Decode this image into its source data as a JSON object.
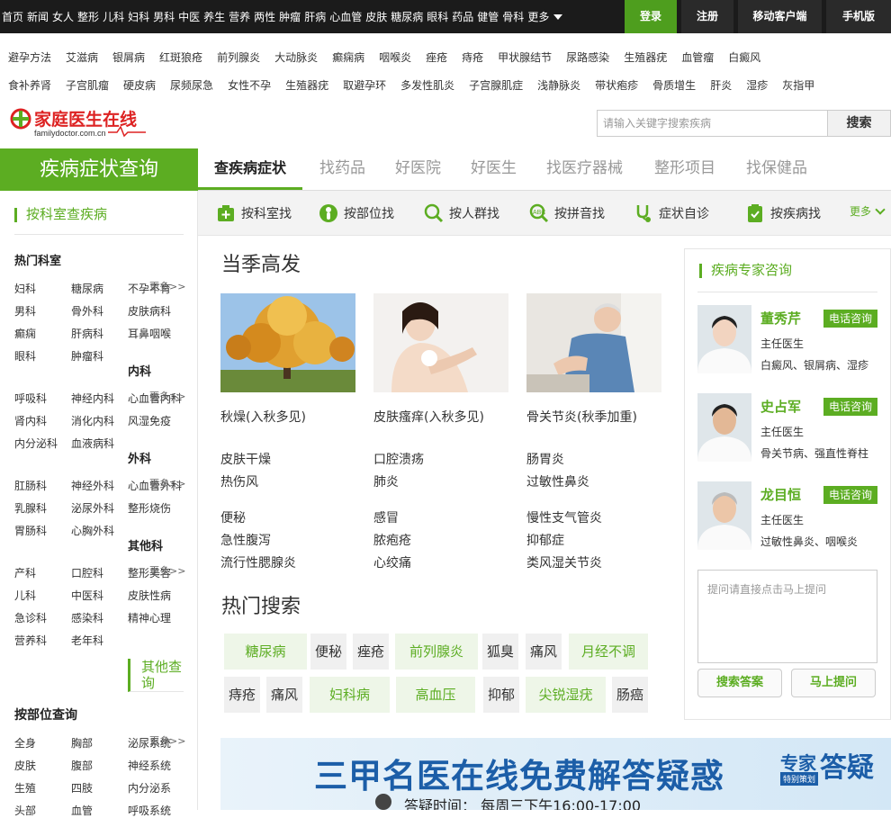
{
  "topnav": {
    "items": [
      "首页",
      "新闻",
      "女人",
      "整形",
      "儿科",
      "妇科",
      "男科",
      "中医",
      "养生",
      "营养",
      "两性",
      "肿瘤",
      "肝病",
      "心血管",
      "皮肤",
      "糖尿病",
      "眼科",
      "药品",
      "健管",
      "骨科",
      "更多"
    ],
    "login": "登录",
    "register": "注册",
    "mobile_client": "移动客户端",
    "phone_version": "手机版"
  },
  "keywords": {
    "row1": [
      "避孕方法",
      "艾滋病",
      "银屑病",
      "红斑狼疮",
      "前列腺炎",
      "大动脉炎",
      "癫痫病",
      "咽喉炎",
      "痤疮",
      "痔疮",
      "甲状腺结节",
      "尿路感染",
      "生殖器疣",
      "血管瘤",
      "白癜风"
    ],
    "row2": [
      "食补养肾",
      "子宫肌瘤",
      "硬皮病",
      "尿频尿急",
      "女性不孕",
      "生殖器疣",
      "取避孕环",
      "多发性肌炎",
      "子宫腺肌症",
      "浅静脉炎",
      "带状疱疹",
      "骨质增生",
      "肝炎",
      "湿疹",
      "灰指甲"
    ]
  },
  "logo": {
    "name": "家庭医生在线",
    "domain": "familydoctor.com.cn"
  },
  "search": {
    "placeholder": "请输入关键字搜索疾病",
    "button": "搜索"
  },
  "nav_title": "疾病症状查询",
  "main_tabs": [
    "查疾病症状",
    "找药品",
    "好医院",
    "好医生",
    "找医疗器械",
    "整形项目",
    "找保健品"
  ],
  "left": {
    "section1_title": "按科室查疾病",
    "hot_dept": "热门科室",
    "hot_dept_items": [
      [
        "妇科",
        "糖尿病",
        "不孕不育"
      ],
      [
        "男科",
        "骨外科",
        "皮肤病科"
      ],
      [
        "癫痫",
        "肝病科",
        "耳鼻咽喉"
      ],
      [
        "眼科",
        "肿瘤科",
        ""
      ]
    ],
    "more": "更多>>",
    "internal": "内科",
    "internal_items": [
      [
        "呼吸科",
        "神经内科",
        "心血管内科"
      ],
      [
        "肾内科",
        "消化内科",
        "风湿免疫"
      ],
      [
        "内分泌科",
        "血液病科",
        ""
      ]
    ],
    "surgery": "外科",
    "surgery_items": [
      [
        "肛肠科",
        "神经外科",
        "心血管外科"
      ],
      [
        "乳腺科",
        "泌尿外科",
        "整形烧伤"
      ],
      [
        "胃肠科",
        "心胸外科",
        ""
      ]
    ],
    "other": "其他科",
    "other_items": [
      [
        "产科",
        "口腔科",
        "整形美容"
      ],
      [
        "儿科",
        "中医科",
        "皮肤性病"
      ],
      [
        "急诊科",
        "感染科",
        "精神心理"
      ],
      [
        "营养科",
        "老年科",
        ""
      ]
    ],
    "other_query": "其他查询",
    "section2_title": "按部位查询",
    "body_items": [
      [
        "全身",
        "胸部",
        "泌尿系统"
      ],
      [
        "皮肤",
        "腹部",
        "神经系统"
      ],
      [
        "生殖",
        "四肢",
        "内分泌系"
      ],
      [
        "头部",
        "血管",
        "呼吸系统"
      ]
    ]
  },
  "subnav": [
    "按科室找",
    "按部位找",
    "按人群找",
    "按拼音找",
    "症状自诊",
    "按疾病找"
  ],
  "subnav_more": "更多",
  "season": {
    "title": "当季高发",
    "cards": [
      {
        "caption": "秋燥(入秋多见)"
      },
      {
        "caption": "皮肤瘙痒(入秋多见)"
      },
      {
        "caption": "骨关节炎(秋季加重)"
      }
    ],
    "diseases": [
      [
        "皮肤干燥",
        "口腔溃疡",
        "肠胃炎"
      ],
      [
        "热伤风",
        "肺炎",
        "过敏性鼻炎"
      ],
      [
        "便秘",
        "感冒",
        "慢性支气管炎"
      ],
      [
        "急性腹泻",
        "脓疱疮",
        "抑郁症"
      ],
      [
        "流行性腮腺炎",
        "心绞痛",
        "类风湿关节炎"
      ]
    ]
  },
  "hot_search": {
    "title": "热门搜索",
    "row1": [
      "糖尿病",
      "便秘",
      "痤疮",
      "前列腺炎",
      "狐臭",
      "痛风",
      "月经不调"
    ],
    "row2": [
      "痔疮",
      "痛风",
      "妇科病",
      "高血压",
      "抑郁",
      "尖锐湿疣",
      "肠癌"
    ]
  },
  "experts": {
    "title": "疾病专家咨询",
    "consult": "电话咨询",
    "doctors": [
      {
        "name": "董秀芹",
        "title": "主任医生",
        "spec": "白癜风、银屑病、湿疹"
      },
      {
        "name": "史占军",
        "title": "主任医生",
        "spec": "骨关节病、强直性脊柱"
      },
      {
        "name": "龙目恒",
        "title": "主任医生",
        "spec": "过敏性鼻炎、咽喉炎"
      }
    ],
    "ask_placeholder": "提问请直接点击马上提问",
    "search_answer": "搜索答案",
    "ask_now": "马上提问"
  },
  "banner": {
    "headline": "三甲名医在线免费解答疑惑",
    "time": "答疑时间：  每周三下午16:00-17:00",
    "tag1": "专家",
    "tag2": "特别策划",
    "tag3": "答疑"
  },
  "colors": {
    "brand_green": "#5cad22",
    "topbar": "#1b1b1b"
  }
}
